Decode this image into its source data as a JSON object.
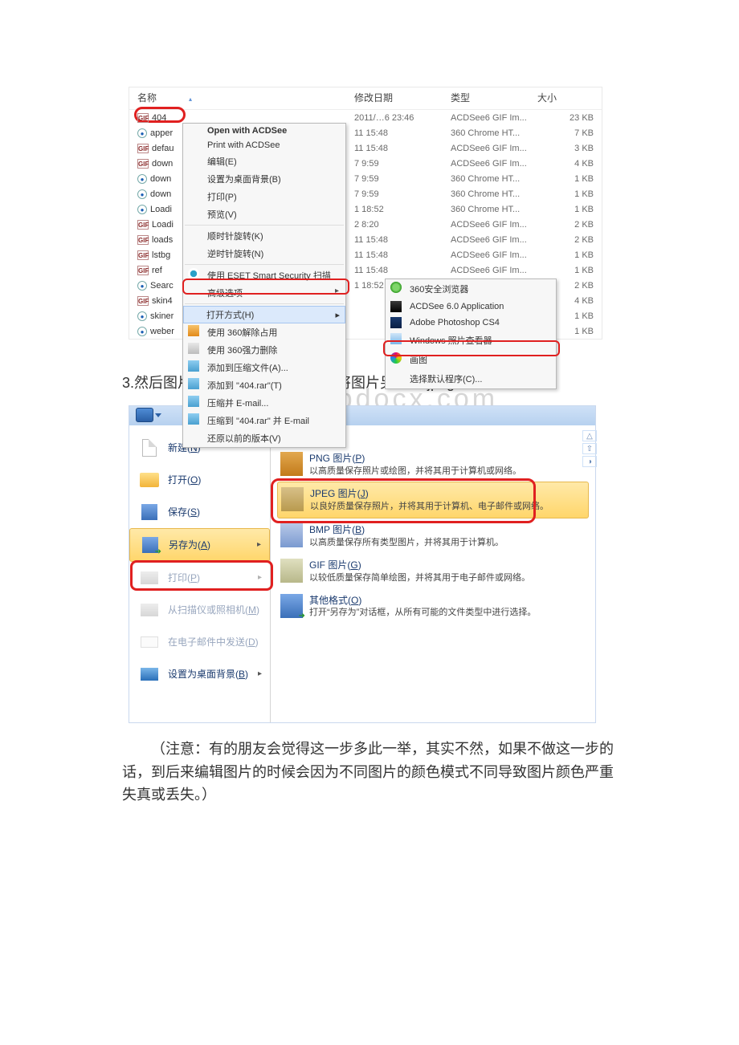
{
  "explorer": {
    "headers": {
      "name": "名称",
      "date": "修改日期",
      "type": "类型",
      "size": "大小"
    },
    "sort_indicator": "▴",
    "rows": [
      {
        "icon": "gif",
        "name": "404",
        "date": "2011/…6 23:46",
        "type": "ACDSee6 GIF Im...",
        "size": "23 KB"
      },
      {
        "icon": "html",
        "name": "apper",
        "date": "11 15:48",
        "type": "360 Chrome HT...",
        "size": "7 KB"
      },
      {
        "icon": "gif",
        "name": "defau",
        "date": "11 15:48",
        "type": "ACDSee6 GIF Im...",
        "size": "3 KB"
      },
      {
        "icon": "gif",
        "name": "down",
        "date": "7 9:59",
        "type": "ACDSee6 GIF Im...",
        "size": "4 KB"
      },
      {
        "icon": "html",
        "name": "down",
        "date": "7 9:59",
        "type": "360 Chrome HT...",
        "size": "1 KB"
      },
      {
        "icon": "html",
        "name": "down",
        "date": "7 9:59",
        "type": "360 Chrome HT...",
        "size": "1 KB"
      },
      {
        "icon": "html",
        "name": "Loadi",
        "date": "1 18:52",
        "type": "360 Chrome HT...",
        "size": "1 KB"
      },
      {
        "icon": "gif",
        "name": "Loadi",
        "date": "2 8:20",
        "type": "ACDSee6 GIF Im...",
        "size": "2 KB"
      },
      {
        "icon": "gif",
        "name": "loads",
        "date": "11 15:48",
        "type": "ACDSee6 GIF Im...",
        "size": "2 KB"
      },
      {
        "icon": "gif",
        "name": "lstbg",
        "date": "11 15:48",
        "type": "ACDSee6 GIF Im...",
        "size": "1 KB"
      },
      {
        "icon": "gif",
        "name": "ref",
        "date": "11 15:48",
        "type": "ACDSee6 GIF Im...",
        "size": "1 KB"
      },
      {
        "icon": "html",
        "name": "Searc",
        "date": "1 18:52",
        "type": "360 Chrome HT...",
        "size": "2 KB"
      },
      {
        "icon": "gif",
        "name": "skin4",
        "date": "",
        "type": "",
        "size": "4 KB"
      },
      {
        "icon": "html",
        "name": "skiner",
        "date": "",
        "type": "",
        "size": "1 KB"
      },
      {
        "icon": "html",
        "name": "weber",
        "date": "",
        "type": "",
        "size": "1 KB"
      }
    ],
    "context_menu": {
      "items": [
        {
          "label": "Open with ACDSee",
          "bold": true
        },
        {
          "label": "Print with ACDSee"
        },
        {
          "label": "编辑(E)"
        },
        {
          "label": "设置为桌面背景(B)"
        },
        {
          "label": "打印(P)"
        },
        {
          "label": "预览(V)"
        },
        {
          "sep": true
        },
        {
          "label": "顺时针旋转(K)"
        },
        {
          "label": "逆时针旋转(N)"
        },
        {
          "sep": true
        },
        {
          "label": "使用 ESET Smart Security 扫描",
          "icon": "eset"
        },
        {
          "label": "高级选项",
          "arrow": true
        },
        {
          "sep": true
        },
        {
          "label": "打开方式(H)",
          "arrow": true,
          "highlight": true
        },
        {
          "label": "使用 360解除占用",
          "icon": "360o"
        },
        {
          "label": "使用 360强力删除",
          "icon": "360d"
        },
        {
          "label": "添加到压缩文件(A)...",
          "icon": "rar"
        },
        {
          "label": "添加到 \"404.rar\"(T)",
          "icon": "rar"
        },
        {
          "label": "压缩并 E-mail...",
          "icon": "rar"
        },
        {
          "label": "压缩到 \"404.rar\" 并 E-mail",
          "icon": "rar"
        },
        {
          "label": "还原以前的版本(V)"
        }
      ]
    },
    "open_with": {
      "items": [
        {
          "label": "360安全浏览器",
          "icon": "360b"
        },
        {
          "label": "ACDSee 6.0 Application",
          "icon": "acd"
        },
        {
          "label": "Adobe Photoshop CS4",
          "icon": "ps"
        },
        {
          "label": "Windows 照片查看器",
          "icon": "wpv"
        },
        {
          "label": "画图",
          "icon": "paint"
        },
        {
          "sep": true
        },
        {
          "label": "选择默认程序(C)..."
        }
      ]
    }
  },
  "body_text": {
    "step3": "3.然后图片的什么都不要动，只要将图片另存为 jpeg 格式：",
    "watermark": "WWW.bdocx.com",
    "note": "（注意：有的朋友会觉得这一步多此一举，其实不然，如果不做这一步的话，到后来编辑图片的时候会因为不同图片的颜色模式不同导致图片颜色严重失真或丢失。）"
  },
  "paint": {
    "right_header": "另存为",
    "left": [
      {
        "label": "新建(",
        "hot": "N",
        "tail": ")",
        "icon": "new"
      },
      {
        "label": "打开(",
        "hot": "O",
        "tail": ")",
        "icon": "open"
      },
      {
        "label": "保存(",
        "hot": "S",
        "tail": ")",
        "icon": "save"
      },
      {
        "label": "另存为(",
        "hot": "A",
        "tail": ")",
        "icon": "saveas",
        "selected": true,
        "arrow": true
      },
      {
        "label": "打印(",
        "hot": "P",
        "tail": ")",
        "icon": "print",
        "arrow": true,
        "faded": true
      },
      {
        "label": "从扫描仪或照相机(",
        "hot": "M",
        "tail": ")",
        "icon": "scan",
        "faded": true
      },
      {
        "label": "在电子邮件中发送(",
        "hot": "D",
        "tail": ")",
        "icon": "email",
        "faded": true
      },
      {
        "label": "设置为桌面背景(",
        "hot": "B",
        "tail": ")",
        "icon": "wall",
        "arrow": true
      }
    ],
    "formats": [
      {
        "title": "PNG 图片(",
        "hot": "P",
        "tail": ")",
        "desc": "以高质量保存照片或绘图，并将其用于计算机或网络。",
        "icon": "png"
      },
      {
        "title": "JPEG 图片(",
        "hot": "J",
        "tail": ")",
        "desc": "以良好质量保存照片，并将其用于计算机、电子邮件或网络。",
        "icon": "jpeg",
        "selected": true
      },
      {
        "title": "BMP 图片(",
        "hot": "B",
        "tail": ")",
        "desc": "以高质量保存所有类型图片，并将其用于计算机。",
        "icon": "bmp"
      },
      {
        "title": "GIF 图片(",
        "hot": "G",
        "tail": ")",
        "desc": "以较低质量保存简单绘图，并将其用于电子邮件或网络。",
        "icon": "gif"
      },
      {
        "title": "其他格式(",
        "hot": "O",
        "tail": ")",
        "desc": "打开“另存为”对话框，从所有可能的文件类型中进行选择。",
        "icon": "other"
      }
    ]
  }
}
